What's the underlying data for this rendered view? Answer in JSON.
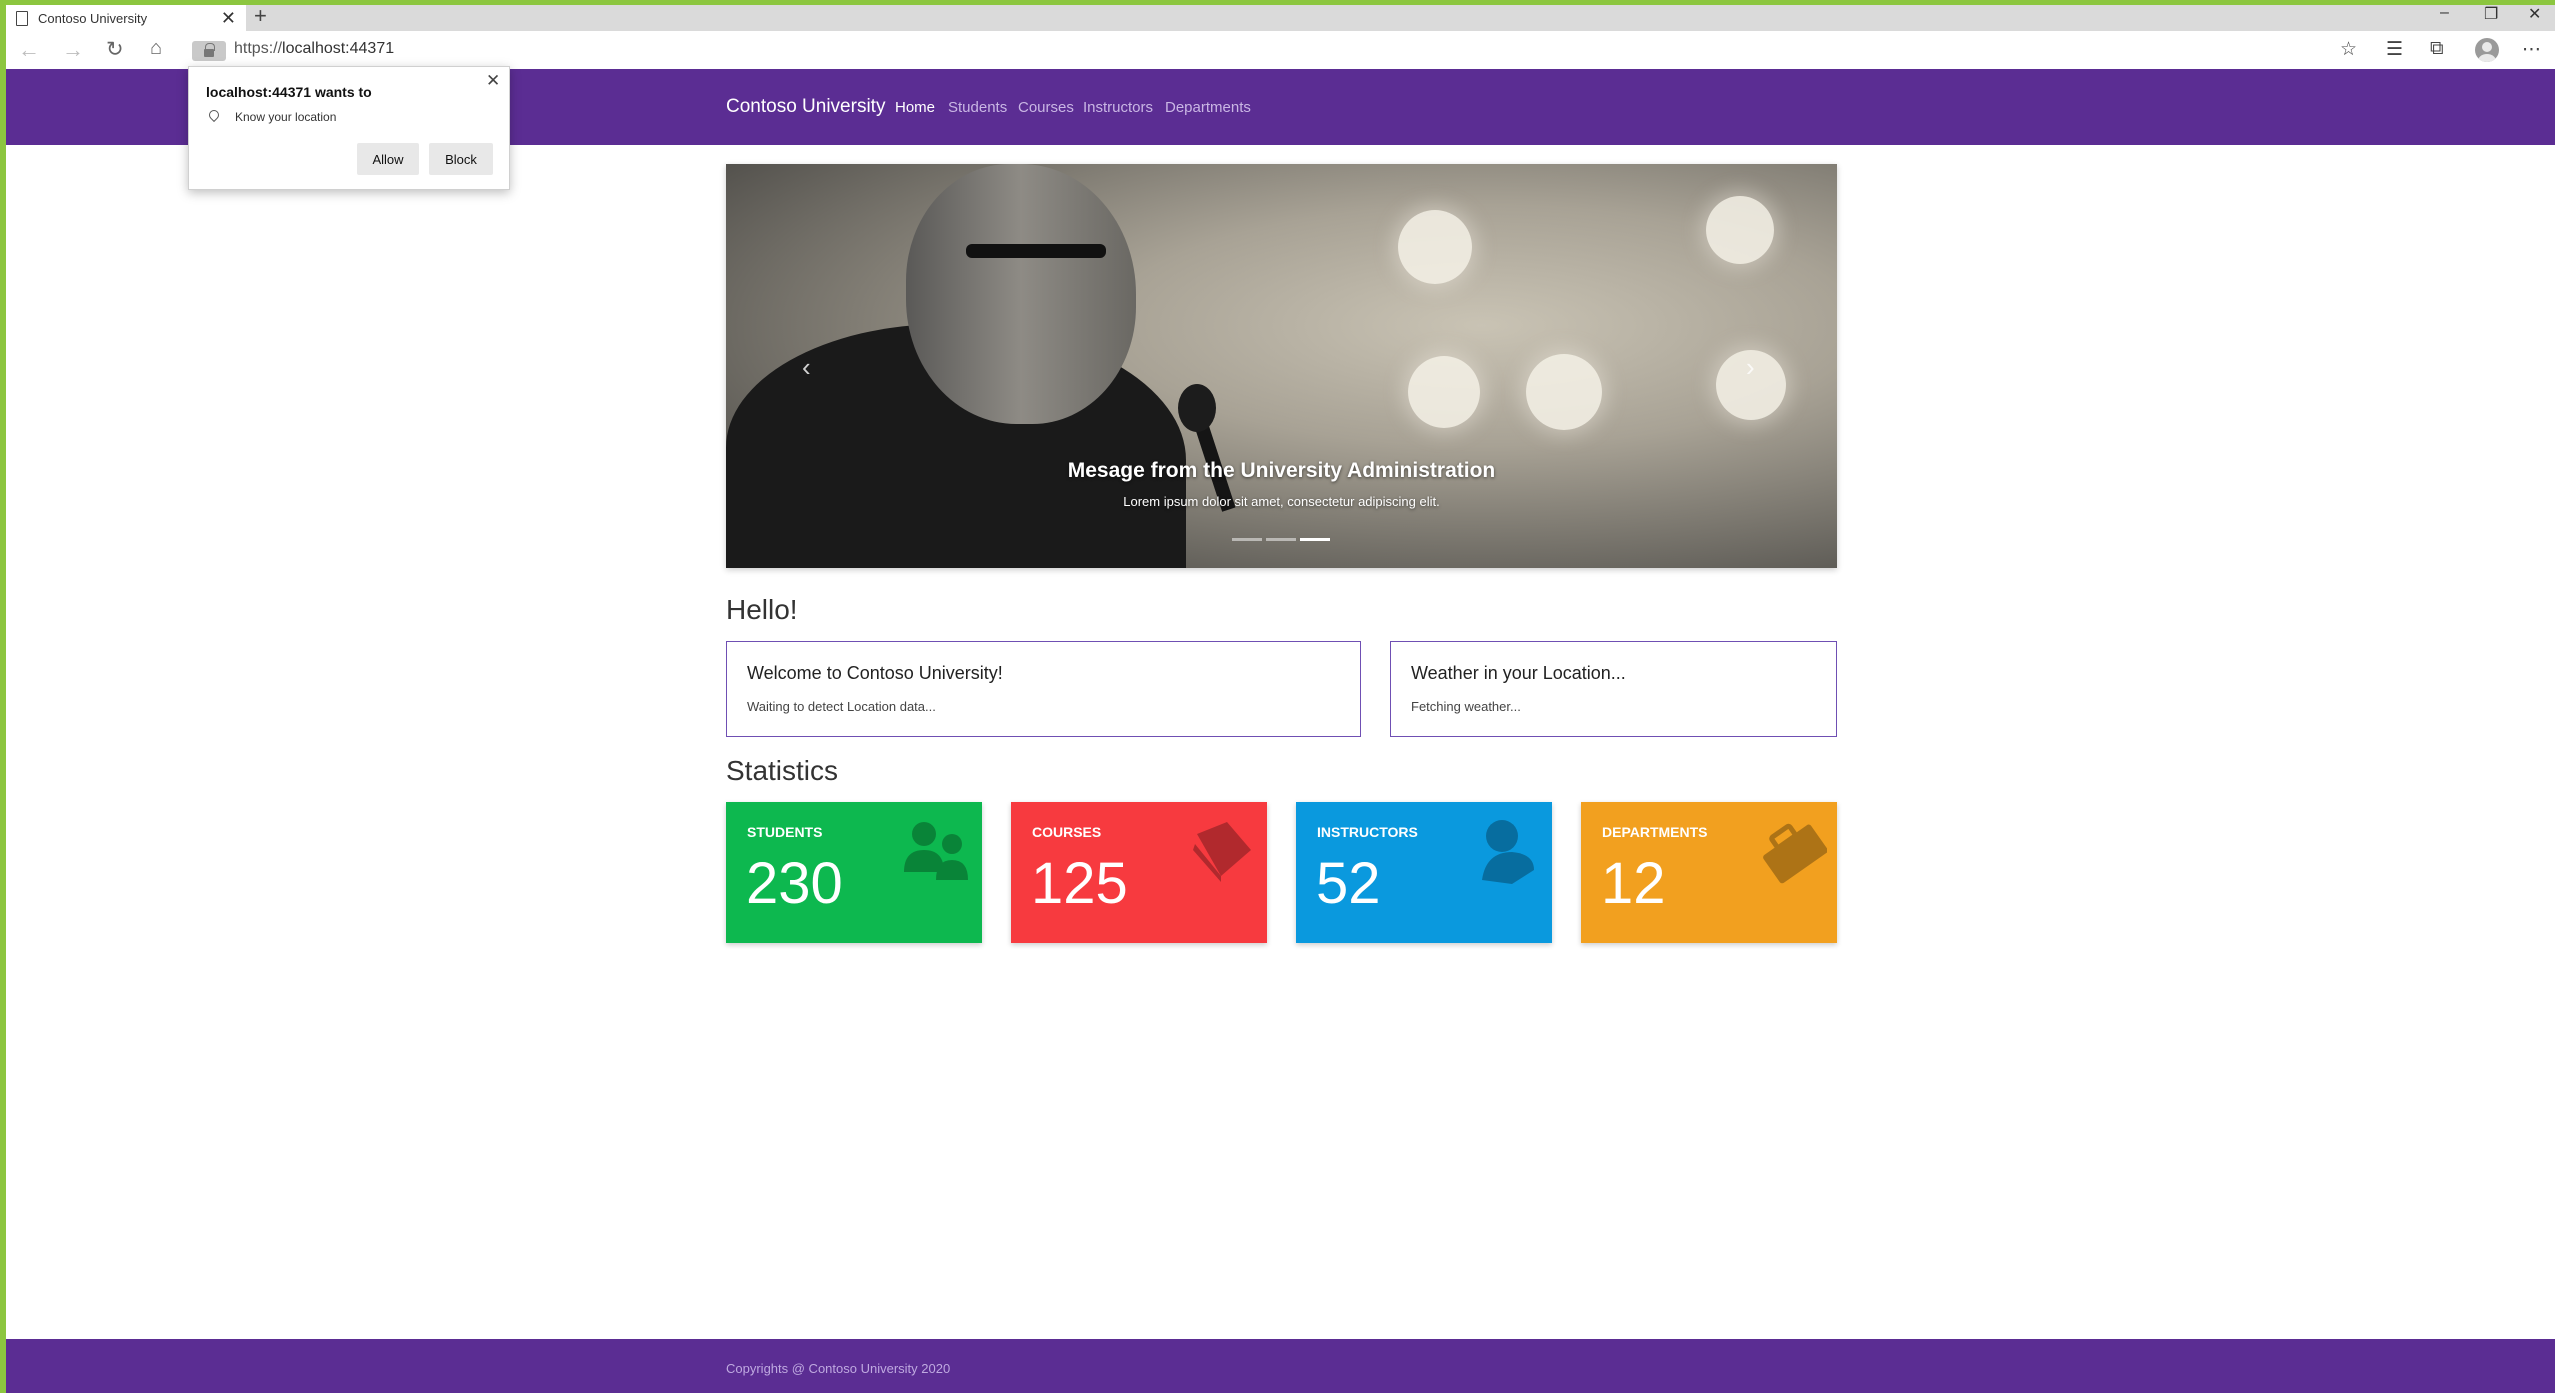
{
  "browser": {
    "tab_title": "Contoso University",
    "new_tab": "+",
    "url_scheme": "https://",
    "url_host": "localhost:44371",
    "window_controls": [
      "–",
      "❐",
      "✕"
    ]
  },
  "permission_popup": {
    "title": "localhost:44371 wants to",
    "request": "Know your location",
    "allow_label": "Allow",
    "block_label": "Block",
    "close": "✕"
  },
  "navbar": {
    "brand": "Contoso University",
    "links": [
      "Home",
      "Students",
      "Courses",
      "Instructors",
      "Departments"
    ],
    "active": "Home",
    "color": "#5b2d93"
  },
  "carousel": {
    "caption_title": "Mesage from the University Administration",
    "caption_text": "Lorem ipsum dolor sit amet, consectetur adipiscing elit.",
    "prev": "‹",
    "next": "›",
    "slide_count": 3,
    "active_slide": 3
  },
  "hello": {
    "heading": "Hello!",
    "welcome_title": "Welcome to Contoso University!",
    "welcome_text": "Waiting to detect Location data...",
    "weather_title": "Weather in your Location...",
    "weather_text": "Fetching weather..."
  },
  "statistics": {
    "heading": "Statistics",
    "tiles": [
      {
        "label": "STUDENTS",
        "value": "230",
        "color": "#0db84f",
        "icon": "users-icon"
      },
      {
        "label": "COURSES",
        "value": "125",
        "color": "#f73a3f",
        "icon": "book-icon"
      },
      {
        "label": "INSTRUCTORS",
        "value": "52",
        "color": "#0a99de",
        "icon": "user-icon"
      },
      {
        "label": "DEPARTMENTS",
        "value": "12",
        "color": "#f2a01f",
        "icon": "briefcase-icon"
      }
    ]
  },
  "footer": {
    "text": "Copyrights @ Contoso University 2020"
  }
}
